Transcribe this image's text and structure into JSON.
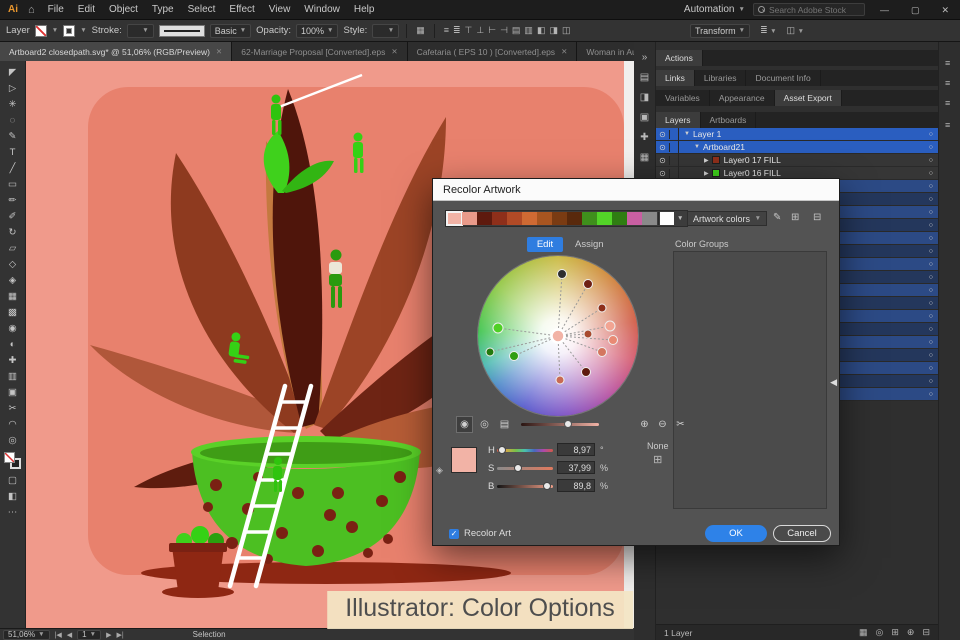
{
  "menubar": {
    "logo": "Ai",
    "items": [
      "File",
      "Edit",
      "Object",
      "Type",
      "Select",
      "Effect",
      "View",
      "Window",
      "Help"
    ],
    "automation": "Automation",
    "search_placeholder": "Search Adobe Stock"
  },
  "controlbar": {
    "left_label": "Layer",
    "stroke_label": "Stroke:",
    "brush_name": "Basic",
    "opacity_label": "Opacity:",
    "opacity_value": "100%",
    "style_label": "Style:",
    "transform_label": "Transform",
    "align_icons": [
      "≡",
      "≣",
      "⊤",
      "⊥",
      "⊢",
      "⊣",
      "▤",
      "▥",
      "◧",
      "◨",
      "◫"
    ]
  },
  "doc_tabs": [
    {
      "label": "Artboard2 closedpath.svg* @ 51,06% (RGB/Preview)",
      "active": true
    },
    {
      "label": "62-Marriage Proposal [Converted].eps",
      "active": false
    },
    {
      "label": "Cafetaria ( EPS 10 ) [Converted].eps",
      "active": false
    },
    {
      "label": "Woman in Autumn with Plant an",
      "active": false
    }
  ],
  "tools": [
    {
      "name": "selection",
      "glyph": "◤"
    },
    {
      "name": "direct-selection",
      "glyph": "▷"
    },
    {
      "name": "magic-wand",
      "glyph": "✳"
    },
    {
      "name": "lasso",
      "glyph": "◌"
    },
    {
      "name": "pen",
      "glyph": "✎"
    },
    {
      "name": "type",
      "glyph": "T"
    },
    {
      "name": "line-segment",
      "glyph": "╱"
    },
    {
      "name": "rectangle",
      "glyph": "▭"
    },
    {
      "name": "paintbrush",
      "glyph": "✏"
    },
    {
      "name": "pencil",
      "glyph": "✐"
    },
    {
      "name": "rotate",
      "glyph": "↻"
    },
    {
      "name": "scale",
      "glyph": "▱"
    },
    {
      "name": "free-transform",
      "glyph": "◇"
    },
    {
      "name": "shape-builder",
      "glyph": "◈"
    },
    {
      "name": "mesh",
      "glyph": "▦"
    },
    {
      "name": "gradient",
      "glyph": "▩"
    },
    {
      "name": "eyedropper",
      "glyph": "◉"
    },
    {
      "name": "blend",
      "glyph": "◐"
    },
    {
      "name": "symbol-sprayer",
      "glyph": "✚"
    },
    {
      "name": "column-graph",
      "glyph": "▥"
    },
    {
      "name": "artboard",
      "glyph": "▣"
    },
    {
      "name": "slice",
      "glyph": "✂"
    },
    {
      "name": "hand",
      "glyph": "◠"
    },
    {
      "name": "zoom",
      "glyph": "◎"
    }
  ],
  "canvas_colors": {
    "pasteboard": "#f09a8b",
    "artboard": "#e8816d",
    "pot_green": "#4cbf22",
    "shadow": "#8e2713"
  },
  "dialog": {
    "title": "Recolor Artwork",
    "swatches": [
      "#f2b3a6",
      "#e99a8a",
      "#5e1a0e",
      "#8e2f1a",
      "#b14a26",
      "#cf6a33",
      "#a85520",
      "#7a3b12",
      "#59290c",
      "#3f8f1c",
      "#53d428",
      "#2f7d12",
      "#c95fa2",
      "#8a8a8a"
    ],
    "artwork_colors": "Artwork colors",
    "edit_tab": "Edit",
    "assign_tab": "Assign",
    "color_groups": "Color Groups",
    "current_color": "#f2b3a6",
    "wheel_markers": [
      {
        "x": -60,
        "y": -8,
        "r": 5,
        "color": "#4fd026"
      },
      {
        "x": -44,
        "y": 20,
        "r": 4.5,
        "color": "#2f9e12"
      },
      {
        "x": -68,
        "y": 16,
        "r": 4,
        "color": "#237a0e"
      },
      {
        "x": 4,
        "y": -62,
        "r": 4.5,
        "color": "#2e2e2e"
      },
      {
        "x": 30,
        "y": -52,
        "r": 4.5,
        "color": "#6e2014"
      },
      {
        "x": 44,
        "y": -28,
        "r": 4,
        "color": "#8e2f1a"
      },
      {
        "x": 52,
        "y": -10,
        "r": 5,
        "color": "#f2a492"
      },
      {
        "x": 55,
        "y": 4,
        "r": 4.5,
        "color": "#e98a74"
      },
      {
        "x": 44,
        "y": 16,
        "r": 4.5,
        "color": "#d4765f"
      },
      {
        "x": 30,
        "y": -2,
        "r": 4,
        "color": "#a84a2e"
      },
      {
        "x": 28,
        "y": 36,
        "r": 4.5,
        "color": "#5e1a0e"
      },
      {
        "x": 2,
        "y": 44,
        "r": 4,
        "color": "#c86a54"
      }
    ],
    "h": {
      "label": "H",
      "value": "8,97",
      "unit": "°",
      "pct": 9
    },
    "s": {
      "label": "S",
      "value": "37,99",
      "unit": "%",
      "pct": 38
    },
    "b": {
      "label": "B",
      "value": "89,8",
      "unit": "%",
      "pct": 90
    },
    "none_label": "None",
    "recolor_art": "Recolor Art",
    "ok": "OK",
    "cancel": "Cancel"
  },
  "panels": {
    "actions_tabs": [
      "Actions"
    ],
    "links_tabs": [
      "Links",
      "Libraries",
      "Document Info"
    ],
    "var_tabs": [
      "Variables",
      "Appearance",
      "Asset Export"
    ],
    "layers_tabs": [
      "Layers",
      "Artboards"
    ],
    "layers_named": [
      {
        "label": "Layer 1",
        "indent": 0,
        "arrow": "down",
        "bright": true
      },
      {
        "label": "Artboard21",
        "indent": 1,
        "arrow": "down",
        "bright": true
      },
      {
        "label": "Layer0 17 FILL",
        "indent": 2,
        "arrow": "right",
        "chip": "#8e2f1a"
      },
      {
        "label": "Layer0 16 FILL",
        "indent": 2,
        "arrow": "right",
        "chip": "#3fd11c"
      }
    ],
    "extra_row_count": 17,
    "chip_cycle": [
      "#8e2f1a",
      "#3fd11c",
      "#5e1a0e",
      "#b0573a",
      "#2f9e12"
    ],
    "layer_count": "1 Layer",
    "dock_strip_icons": [
      {
        "name": "collapse-panels",
        "glyph": "»"
      },
      {
        "name": "libraries-panel",
        "glyph": "▤"
      },
      {
        "name": "color-panel",
        "glyph": "◨"
      },
      {
        "name": "swatches-panel",
        "glyph": "▣"
      },
      {
        "name": "brushes-panel",
        "glyph": "✚"
      },
      {
        "name": "symbols-panel",
        "glyph": "▦"
      }
    ],
    "bottom_icons": [
      {
        "name": "collect-for-export",
        "glyph": "▦"
      },
      {
        "name": "make-mask",
        "glyph": "◎"
      },
      {
        "name": "new-sublayer",
        "glyph": "⊞"
      },
      {
        "name": "new-layer",
        "glyph": "⊕"
      },
      {
        "name": "delete-layer",
        "glyph": "⊟"
      }
    ]
  },
  "statusbar": {
    "zoom": "51,06%",
    "artboard_nav": "1",
    "tool_label": "Selection"
  },
  "caption": "Illustrator: Color Options"
}
